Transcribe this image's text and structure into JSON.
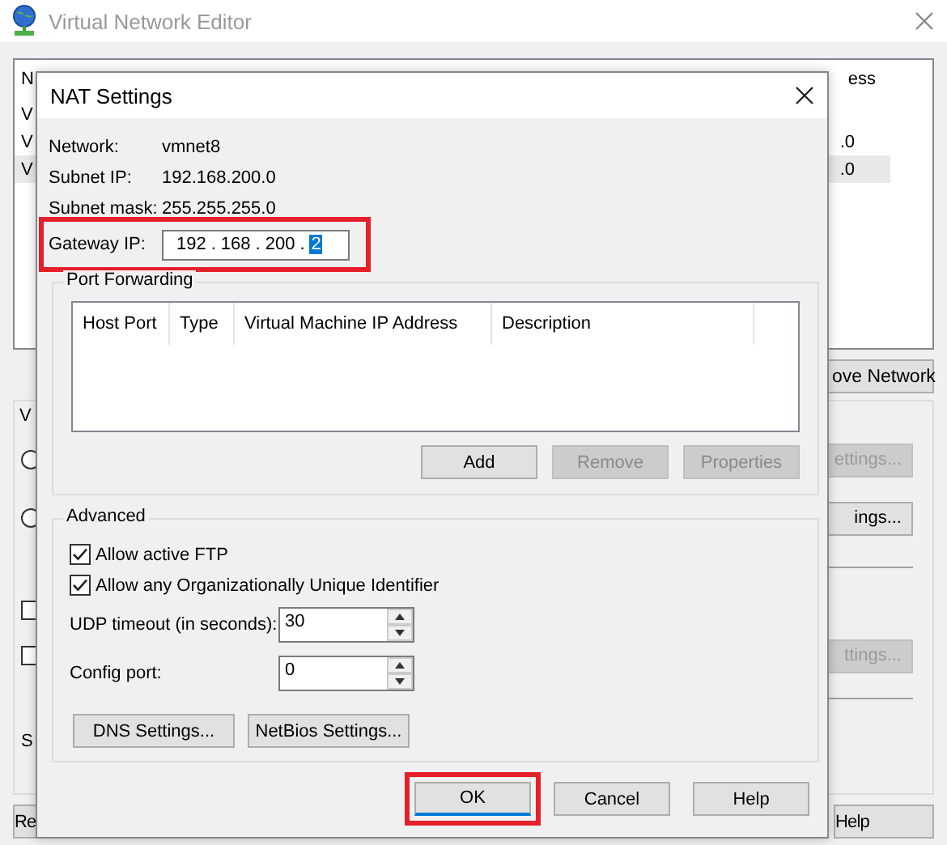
{
  "background_window": {
    "title": "Virtual Network Editor",
    "list": {
      "header": [
        "N",
        "ess"
      ],
      "rows": [
        {
          "cells": [
            "V"
          ],
          "selected": false
        },
        {
          "cells": [
            "V",
            ".0"
          ],
          "selected": false
        },
        {
          "cells": [
            "V",
            ".0"
          ],
          "selected": true
        }
      ]
    },
    "list_button": {
      "label": "ove Network",
      "disabled": false
    },
    "group": {
      "legend": "V",
      "items": [
        {
          "kind": "radio",
          "button": {
            "label": "ettings...",
            "disabled": true
          }
        },
        {
          "kind": "radio",
          "button": {
            "label": "ings...",
            "disabled": false
          }
        },
        {
          "kind": "divider"
        },
        {
          "kind": "checkbox"
        },
        {
          "kind": "checkbox",
          "button": {
            "label": "ttings...",
            "disabled": true
          }
        },
        {
          "kind": "divider"
        },
        {
          "kind": "text",
          "text": "S"
        }
      ]
    },
    "footer_buttons": [
      {
        "label": "Re",
        "disabled": false
      },
      {
        "label": "Help",
        "disabled": false
      }
    ]
  },
  "dialog": {
    "title": "NAT Settings",
    "info": [
      {
        "label": "Network:",
        "value": "vmnet8"
      },
      {
        "label": "Subnet IP:",
        "value": "192.168.200.0"
      },
      {
        "label": "Subnet mask:",
        "value": "255.255.255.0"
      }
    ],
    "gateway": {
      "label": "Gateway IP:",
      "highlighted": true,
      "octets": [
        {
          "text": "192",
          "selected": false
        },
        {
          "text": "168",
          "selected": false
        },
        {
          "text": "200",
          "selected": false
        },
        {
          "text": "2",
          "selected": true
        }
      ],
      "separator": "."
    },
    "port_forwarding": {
      "legend": "Port Forwarding",
      "columns": [
        "Host Port",
        "Type",
        "Virtual Machine IP Address",
        "Description"
      ],
      "buttons": [
        {
          "label": "Add",
          "disabled": false
        },
        {
          "label": "Remove",
          "disabled": true
        },
        {
          "label": "Properties",
          "disabled": true
        }
      ]
    },
    "advanced": {
      "legend": "Advanced",
      "checkboxes": [
        {
          "label": "Allow active FTP",
          "checked": true
        },
        {
          "label": "Allow any Organizationally Unique Identifier",
          "checked": true
        }
      ],
      "spinners": [
        {
          "label": "UDP timeout (in seconds):",
          "value": "30"
        },
        {
          "label": "Config port:",
          "value": "0"
        }
      ],
      "buttons": [
        {
          "label": "DNS Settings...",
          "disabled": false
        },
        {
          "label": "NetBios Settings...",
          "disabled": false
        }
      ]
    },
    "buttons": [
      {
        "label": "OK",
        "disabled": false,
        "default": true,
        "highlighted": true
      },
      {
        "label": "Cancel",
        "disabled": false,
        "default": false,
        "highlighted": false
      },
      {
        "label": "Help",
        "disabled": false,
        "default": false,
        "highlighted": false
      }
    ]
  }
}
